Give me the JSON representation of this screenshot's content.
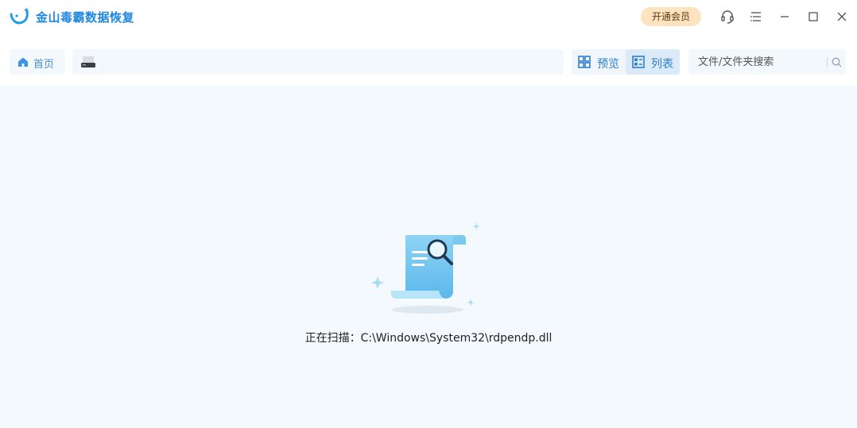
{
  "app": {
    "title": "金山毒霸数据恢复",
    "logo_icon": "kingsoft-fox-logo",
    "vip_button": "开通会员",
    "brand_color": "#1f86e0"
  },
  "window_controls": {
    "icons": [
      "headset-icon",
      "menu-icon",
      "minimize-icon",
      "maximize-icon",
      "close-icon"
    ]
  },
  "toolbar": {
    "home_label": "首页",
    "path_drive_icon": "drive-icon",
    "view_preview_label": "预览",
    "view_list_label": "列表",
    "active_view": "列表",
    "search_placeholder": "文件/文件夹搜索"
  },
  "main": {
    "illustration_icon": "document-magnifier-icon",
    "scan_status": "正在扫描：C:\\Windows\\System32\\rdpendp.dll"
  }
}
